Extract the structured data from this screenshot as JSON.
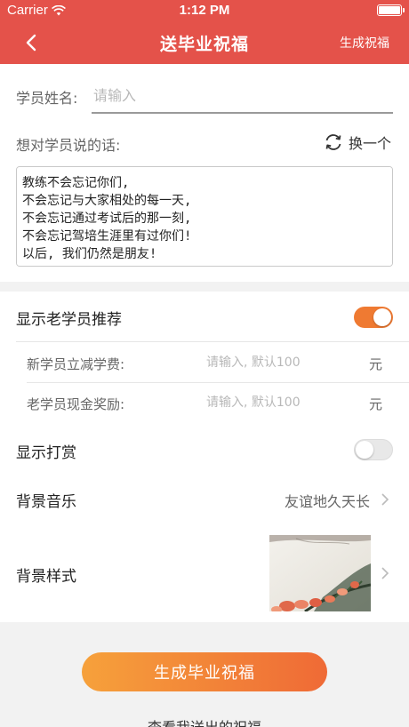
{
  "status_bar": {
    "carrier": "Carrier",
    "time": "1:12 PM"
  },
  "nav": {
    "title": "送毕业祝福",
    "action": "生成祝福"
  },
  "form": {
    "name_label": "学员姓名:",
    "name_placeholder": "请输入",
    "words_label": "想对学员说的话:",
    "refresh_label": "换一个",
    "message": "教练不会忘记你们,\n不会忘记与大家相处的每一天,\n不会忘记通过考试后的那一刻,\n不会忘记驾培生涯里有过你们!\n以后, 我们仍然是朋友!"
  },
  "settings": {
    "referral": {
      "label": "显示老学员推荐",
      "enabled": true
    },
    "new_discount": {
      "label": "新学员立减学费:",
      "placeholder": "请输入, 默认100",
      "unit": "元"
    },
    "old_reward": {
      "label": "老学员现金奖励:",
      "placeholder": "请输入, 默认100",
      "unit": "元"
    },
    "tip": {
      "label": "显示打赏",
      "enabled": false
    },
    "music": {
      "label": "背景音乐",
      "value": "友谊地久天长"
    },
    "style": {
      "label": "背景样式"
    }
  },
  "actions": {
    "generate": "生成毕业祝福",
    "view_sent": "查看我送出的祝福"
  },
  "colors": {
    "header": "#e4524a",
    "accent": "#ef7a32",
    "button_start": "#f6a13b",
    "button_end": "#ef6a36"
  },
  "icons": {
    "wifi": "wifi-icon",
    "back": "back-chevron-icon",
    "refresh": "refresh-icon",
    "chevron": "chevron-right-icon",
    "battery": "battery-icon"
  }
}
